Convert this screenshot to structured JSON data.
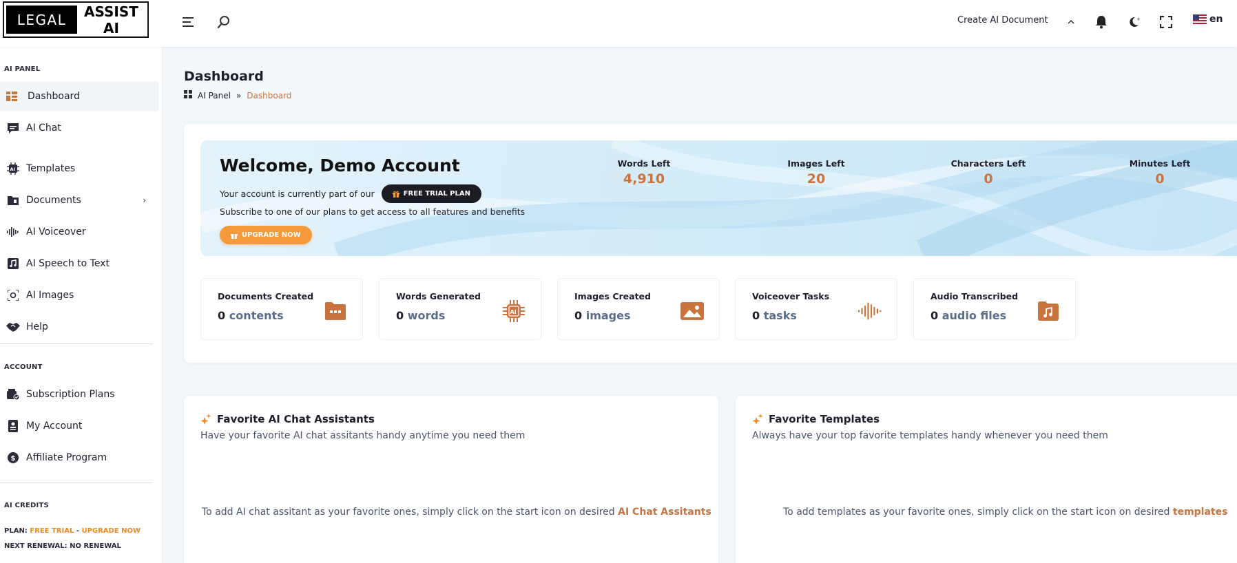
{
  "colors": {
    "accent": "#c9733e",
    "orange": "#f08a24",
    "dark": "#1c1c24",
    "welcome_bg": "#d4ecf8"
  },
  "header": {
    "logo_left": "LEGAL",
    "logo_right": "ASSIST AI",
    "create_document": "Create AI Document",
    "language": "en",
    "icons": [
      "menu-icon",
      "search-icon",
      "chevron-up-icon",
      "bell-icon",
      "moon-icon",
      "fullscreen-icon",
      "us-flag-icon"
    ]
  },
  "sidebar": {
    "section_ai_panel": "AI PANEL",
    "items": [
      {
        "label": "Dashboard",
        "icon": "dashboard-icon"
      },
      {
        "label": "AI Chat",
        "icon": "chat-icon"
      },
      {
        "label": "Templates",
        "icon": "ai-chip-icon"
      },
      {
        "label": "Documents",
        "icon": "folder-icon"
      },
      {
        "label": "AI Voiceover",
        "icon": "waveform-icon"
      },
      {
        "label": "AI Speech to Text",
        "icon": "music-note-icon"
      },
      {
        "label": "AI Images",
        "icon": "image-scan-icon"
      },
      {
        "label": "Help",
        "icon": "handshake-icon"
      }
    ],
    "section_account": "ACCOUNT",
    "account_items": [
      {
        "label": "Subscription Plans",
        "icon": "wallet-icon"
      },
      {
        "label": "My Account",
        "icon": "id-card-icon"
      },
      {
        "label": "Affiliate Program",
        "icon": "dollar-badge-icon"
      }
    ],
    "section_credits": "AI CREDITS",
    "plan_label": "PLAN:",
    "plan_value": "FREE TRIAL",
    "plan_sep": "-",
    "plan_upgrade": "UPGRADE NOW",
    "renewal": "NEXT RENEWAL: NO RENEWAL"
  },
  "page": {
    "title": "Dashboard",
    "breadcrumb_root": "AI Panel",
    "breadcrumb_sep": "»",
    "breadcrumb_current": "Dashboard"
  },
  "welcome": {
    "title": "Welcome, Demo Account",
    "line1": "Your account is currently part of our",
    "plan_badge": "FREE TRIAL PLAN",
    "line2": "Subscribe to one of our plans to get access to all features and benefits",
    "upgrade": "UPGRADE NOW",
    "stats": [
      {
        "label": "Words Left",
        "value": "4,910"
      },
      {
        "label": "Images Left",
        "value": "20"
      },
      {
        "label": "Characters Left",
        "value": "0"
      },
      {
        "label": "Minutes Left",
        "value": "0"
      }
    ]
  },
  "metrics": [
    {
      "title": "Documents Created",
      "count": "0",
      "unit": "contents",
      "icon": "folder-dots-icon"
    },
    {
      "title": "Words Generated",
      "count": "0",
      "unit": "words",
      "icon": "ai-chip-icon"
    },
    {
      "title": "Images Created",
      "count": "0",
      "unit": "images",
      "icon": "image-icon"
    },
    {
      "title": "Voiceover Tasks",
      "count": "0",
      "unit": "tasks",
      "icon": "waveform-icon"
    },
    {
      "title": "Audio Transcribed",
      "count": "0",
      "unit": "audio files",
      "icon": "music-folder-icon"
    }
  ],
  "favorites": {
    "chat": {
      "title": "Favorite AI Chat Assistants",
      "subtitle": "Have your favorite AI chat assitants handy anytime you need them",
      "hint": "To add AI chat assitant as your favorite ones, simply click on the start icon on desired",
      "hint_link": "AI Chat Assitants"
    },
    "templates": {
      "title": "Favorite Templates",
      "subtitle": "Always have your top favorite templates handy whenever you need them",
      "hint": "To add templates as your favorite ones, simply click on the start icon on desired",
      "hint_link": "templates"
    }
  }
}
